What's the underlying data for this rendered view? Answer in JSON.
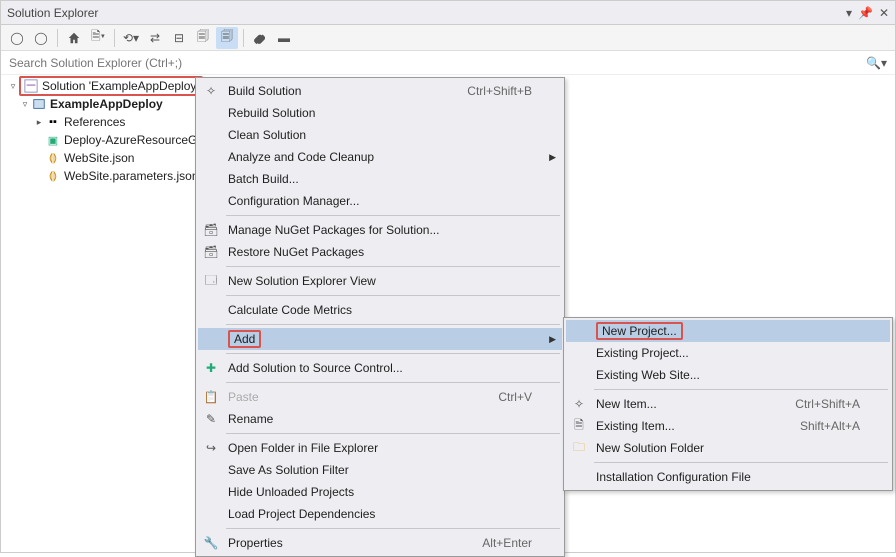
{
  "titlebar": {
    "title": "Solution Explorer"
  },
  "search": {
    "placeholder": "Search Solution Explorer (Ctrl+;)"
  },
  "tree": {
    "solution": "Solution 'ExampleAppDeploy'",
    "project": "ExampleAppDeploy",
    "references": "References",
    "deploy": "Deploy-AzureResourceG",
    "website": "WebSite.json",
    "params": "WebSite.parameters.json"
  },
  "menu": {
    "build": "Build Solution",
    "build_key": "Ctrl+Shift+B",
    "rebuild": "Rebuild Solution",
    "clean": "Clean Solution",
    "analyze": "Analyze and Code Cleanup",
    "batch": "Batch Build...",
    "config": "Configuration Manager...",
    "nuget": "Manage NuGet Packages for Solution...",
    "restore": "Restore NuGet Packages",
    "newview": "New Solution Explorer View",
    "metrics": "Calculate Code Metrics",
    "add": "Add",
    "source": "Add Solution to Source Control...",
    "paste": "Paste",
    "paste_key": "Ctrl+V",
    "rename": "Rename",
    "open": "Open Folder in File Explorer",
    "filter": "Save As Solution Filter",
    "hide": "Hide Unloaded Projects",
    "deps": "Load Project Dependencies",
    "props": "Properties",
    "props_key": "Alt+Enter"
  },
  "submenu": {
    "newproj": "New Project...",
    "existproj": "Existing Project...",
    "existweb": "Existing Web Site...",
    "newitem": "New Item...",
    "newitem_key": "Ctrl+Shift+A",
    "existitem": "Existing Item...",
    "existitem_key": "Shift+Alt+A",
    "newfolder": "New Solution Folder",
    "install": "Installation Configuration File"
  }
}
